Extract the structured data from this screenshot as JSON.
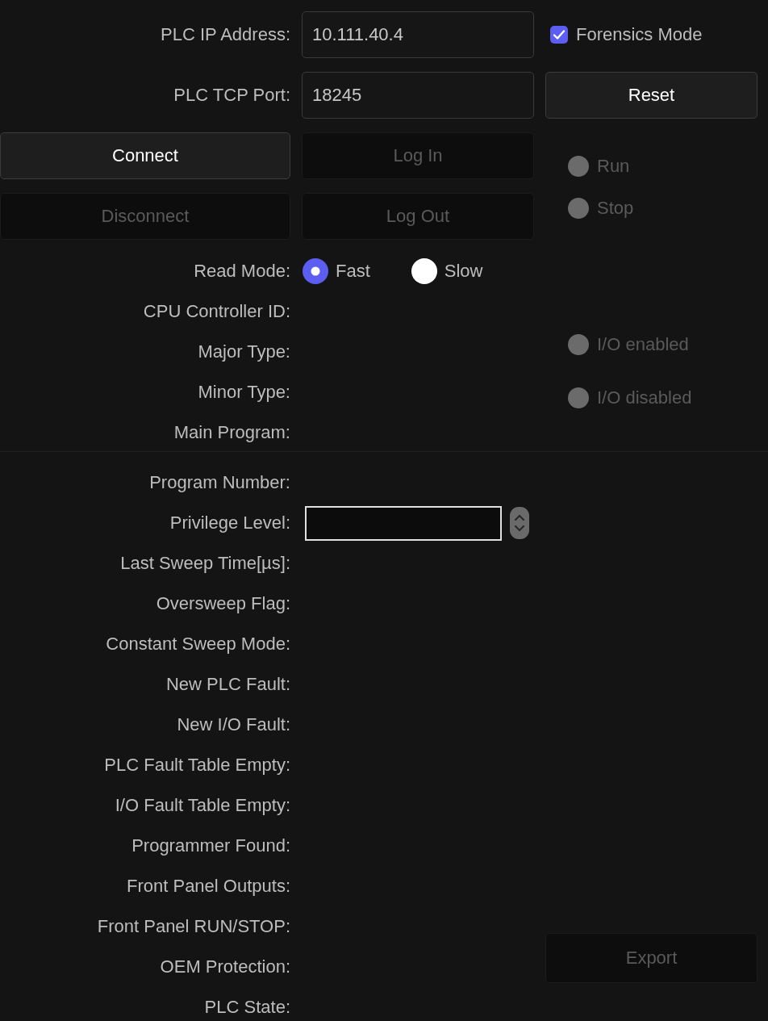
{
  "connection": {
    "fields": [
      {
        "label": "PLC IP Address:",
        "value": "10.111.40.4"
      },
      {
        "label": "PLC TCP Port:",
        "value": "18245"
      }
    ],
    "forensics_mode": {
      "label": "Forensics Mode",
      "checked": true
    },
    "reset_button": {
      "label": "Reset",
      "disabled": false
    },
    "connect_button": {
      "label": "Connect",
      "disabled": false
    },
    "login_button": {
      "label": "Log In",
      "disabled": true
    },
    "disconnect_button": {
      "label": "Disconnect",
      "disabled": true
    },
    "logout_button": {
      "label": "Log Out",
      "disabled": true
    }
  },
  "run_indicators": [
    {
      "label": "Run",
      "on": false
    },
    {
      "label": "Stop",
      "on": false
    }
  ],
  "read_mode": {
    "label": "Read Mode:",
    "options": [
      {
        "label": "Fast",
        "selected": true
      },
      {
        "label": "Slow",
        "selected": false
      }
    ]
  },
  "info_labels": [
    "CPU Controller ID:",
    "Major Type:",
    "Minor Type:",
    "Main Program:"
  ],
  "io_indicators": [
    {
      "label": "I/O enabled",
      "on": false
    },
    {
      "label": "I/O disabled",
      "on": false
    }
  ],
  "status_rows": [
    {
      "kind": "text",
      "label": "Program Number:"
    },
    {
      "kind": "select",
      "label": "Privilege Level:"
    },
    {
      "kind": "text",
      "label": "Last Sweep Time[µs]:"
    },
    {
      "kind": "text",
      "label": "Oversweep Flag:"
    },
    {
      "kind": "text",
      "label": "Constant Sweep Mode:"
    },
    {
      "kind": "text",
      "label": "New PLC Fault:"
    },
    {
      "kind": "text",
      "label": "New I/O Fault:"
    },
    {
      "kind": "text",
      "label": "PLC Fault Table Empty:"
    },
    {
      "kind": "text",
      "label": "I/O Fault Table Empty:"
    },
    {
      "kind": "text",
      "label": "Programmer Found:"
    },
    {
      "kind": "text",
      "label": "Front Panel Outputs:"
    },
    {
      "kind": "text",
      "label": "Front Panel RUN/STOP:"
    },
    {
      "kind": "text",
      "label": "OEM Protection:"
    },
    {
      "kind": "text",
      "label": "PLC State:"
    }
  ],
  "export_button": {
    "label": "Export",
    "disabled": true
  }
}
